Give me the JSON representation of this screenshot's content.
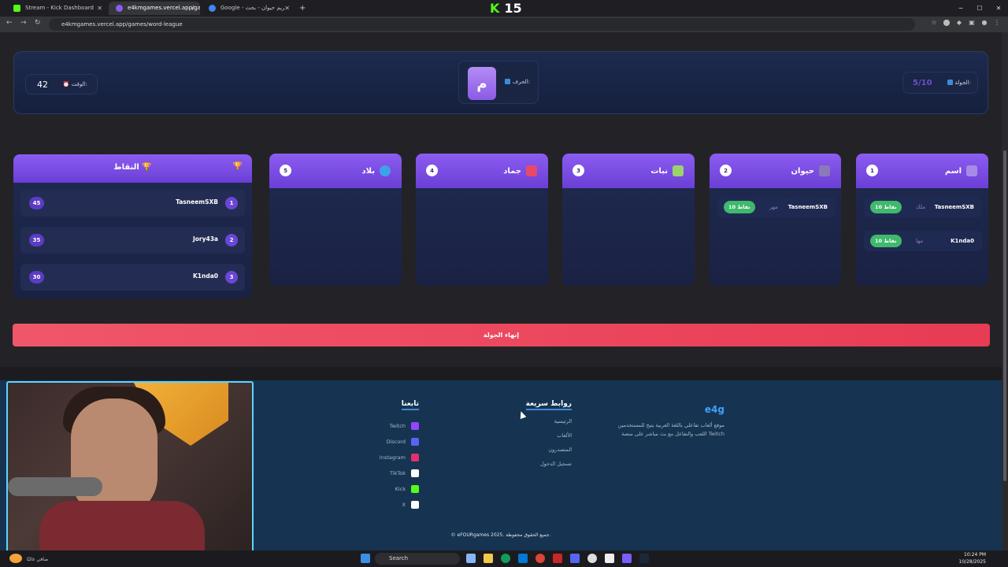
{
  "browser": {
    "tabs": [
      {
        "title": "Stream - Kick Dashboard",
        "color": "#53fc18"
      },
      {
        "title": "e4kmgames.vercel.app/games/",
        "color": "#8c5cf0"
      },
      {
        "title": "Google - ريم حيوان - بحث",
        "color": "#4285f4"
      }
    ],
    "new_tab_symbol": "+",
    "url": "e4kmgames.vercel.app/games/word-league",
    "kick_badge": {
      "logo": "K",
      "count": "15"
    }
  },
  "game": {
    "time_label": "الوقت:",
    "time_value": "42",
    "letter_label": "الحرف:",
    "letter_value": "م",
    "round_label": "الجولة:",
    "round_value": "5/10"
  },
  "scoreboard": {
    "title": "النقاط",
    "rows": [
      {
        "rank": "1",
        "name": "TasneemSXB",
        "score": "45"
      },
      {
        "rank": "2",
        "name": "Jory43a",
        "score": "35"
      },
      {
        "rank": "3",
        "name": "K1nda0",
        "score": "30"
      }
    ]
  },
  "categories": [
    {
      "num": "1",
      "name": "اسم",
      "icon_color": "#a88be8",
      "icon": "person-icon",
      "answers": [
        {
          "player": "TasneemSXB",
          "word": "ملك",
          "points": "10 نقاط"
        },
        {
          "player": "K1nda0",
          "word": "مها",
          "points": "10 نقاط"
        }
      ]
    },
    {
      "num": "2",
      "name": "حيوان",
      "icon_color": "#8c7ab8",
      "icon": "animal-icon",
      "answers": [
        {
          "player": "TasneemSXB",
          "word": "مهر",
          "points": "10 نقاط"
        }
      ]
    },
    {
      "num": "3",
      "name": "نبات",
      "icon_color": "#9bd36b",
      "icon": "plant-icon",
      "answers": []
    },
    {
      "num": "4",
      "name": "جماد",
      "icon_color": "#e6496a",
      "icon": "object-icon",
      "answers": []
    },
    {
      "num": "5",
      "name": "بلاد",
      "icon_color": "#3fa2e8",
      "icon": "globe-icon",
      "answers": []
    }
  ],
  "end_round_label": "إنهاء الجولة",
  "footer": {
    "brand": "e4g",
    "description": "موقع ألعاب تفاعلي باللغة العربية يتيح للمستخدمين اللعب والتفاعل مع بث مباشر على منصة Twitch",
    "quick_links_title": "روابط سريعة",
    "quick_links": [
      "الرئيسية",
      "الألعاب",
      "المتصدرون",
      "تسجيل الدخول"
    ],
    "follow_title": "تابعنا",
    "social": [
      {
        "label": "Twitch",
        "color": "#9146ff"
      },
      {
        "label": "Discord",
        "color": "#5865f2"
      },
      {
        "label": "Instagram",
        "color": "#e1306c"
      },
      {
        "label": "TikTok",
        "color": "#ffffff"
      },
      {
        "label": "Kick",
        "color": "#53fc18"
      },
      {
        "label": "X",
        "color": "#ffffff"
      }
    ],
    "copyright": "© eFOURgames 2025. جميع الحقوق محفوظة."
  },
  "taskbar": {
    "search_placeholder": "Search",
    "time": "10:24 PM",
    "date": "10/28/2025",
    "weather": "صافي غالبًا"
  }
}
